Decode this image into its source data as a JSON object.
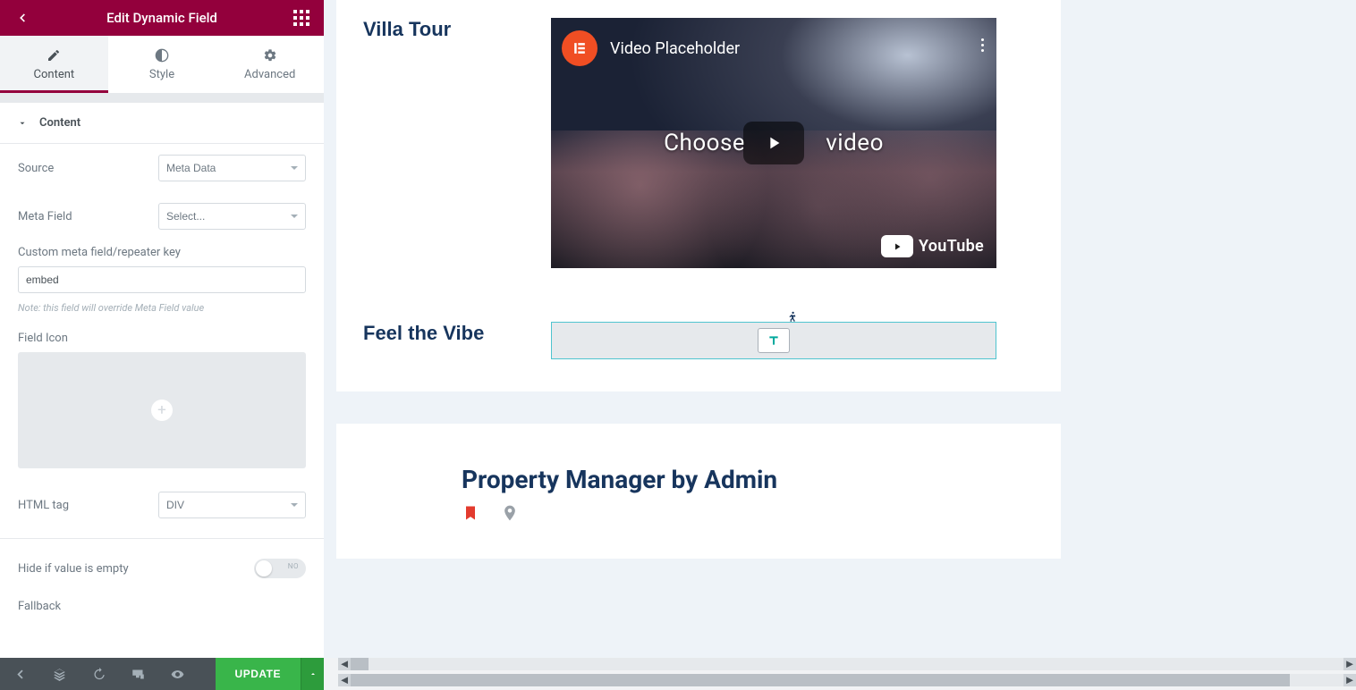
{
  "panel": {
    "title": "Edit Dynamic Field",
    "tabs": {
      "content": "Content",
      "style": "Style",
      "advanced": "Advanced"
    },
    "section": "Content",
    "controls": {
      "source": {
        "label": "Source",
        "value": "Meta Data"
      },
      "metaField": {
        "label": "Meta Field",
        "value": "Select..."
      },
      "customKey": {
        "label": "Custom meta field/repeater key",
        "value": "embed"
      },
      "note": "Note: this field will override Meta Field value",
      "fieldIcon": {
        "label": "Field Icon"
      },
      "htmlTag": {
        "label": "HTML tag",
        "value": "DIV"
      },
      "hideIfEmpty": {
        "label": "Hide if value is empty",
        "off": "NO"
      },
      "fallback": {
        "label": "Fallback"
      }
    }
  },
  "footer": {
    "update": "UPDATE"
  },
  "canvas": {
    "villa": {
      "title": "Villa Tour",
      "video": {
        "title": "Video Placeholder",
        "centerLeft": "Choose",
        "centerRight": "video",
        "brand": "YouTube"
      }
    },
    "vibe": {
      "title": "Feel the Vibe"
    },
    "pm": {
      "title": "Property Manager by Admin"
    }
  }
}
